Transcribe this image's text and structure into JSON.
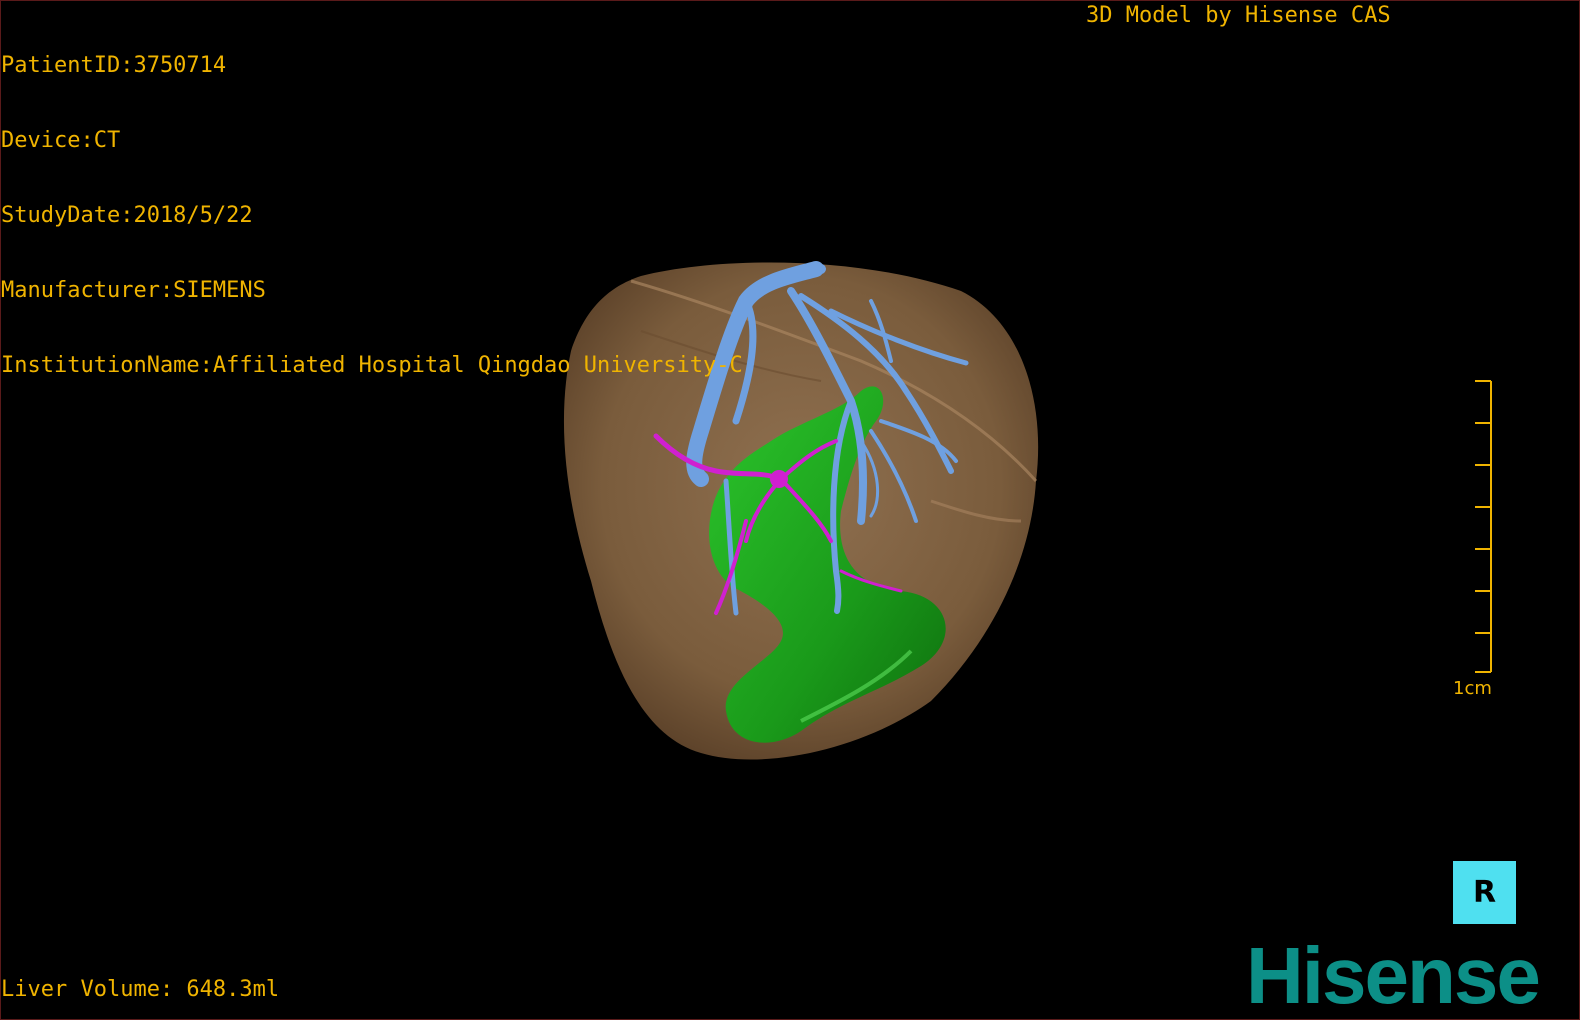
{
  "patient_info": {
    "patient_id": "PatientID:3750714",
    "device": "Device:CT",
    "study_date": "StudyDate:2018/5/22",
    "manufacturer": "Manufacturer:SIEMENS",
    "institution": "InstitutionName:Affiliated Hospital Qingdao University-C"
  },
  "credit": "3D Model by Hisense CAS",
  "liver_volume": "Liver Volume: 648.3ml",
  "scale": {
    "label": "1cm"
  },
  "orientation": {
    "label": "R"
  },
  "brand": {
    "name": "Hisense"
  },
  "colors": {
    "overlay_text": "#f0b400",
    "liver": "#8a6a46",
    "portal_vein": "#6fa0e0",
    "hepatic_artery": "#d020d0",
    "lesion": "#1f9e1f",
    "orientation_cube": "#4fe0f0",
    "brand": "#0c8f87"
  }
}
